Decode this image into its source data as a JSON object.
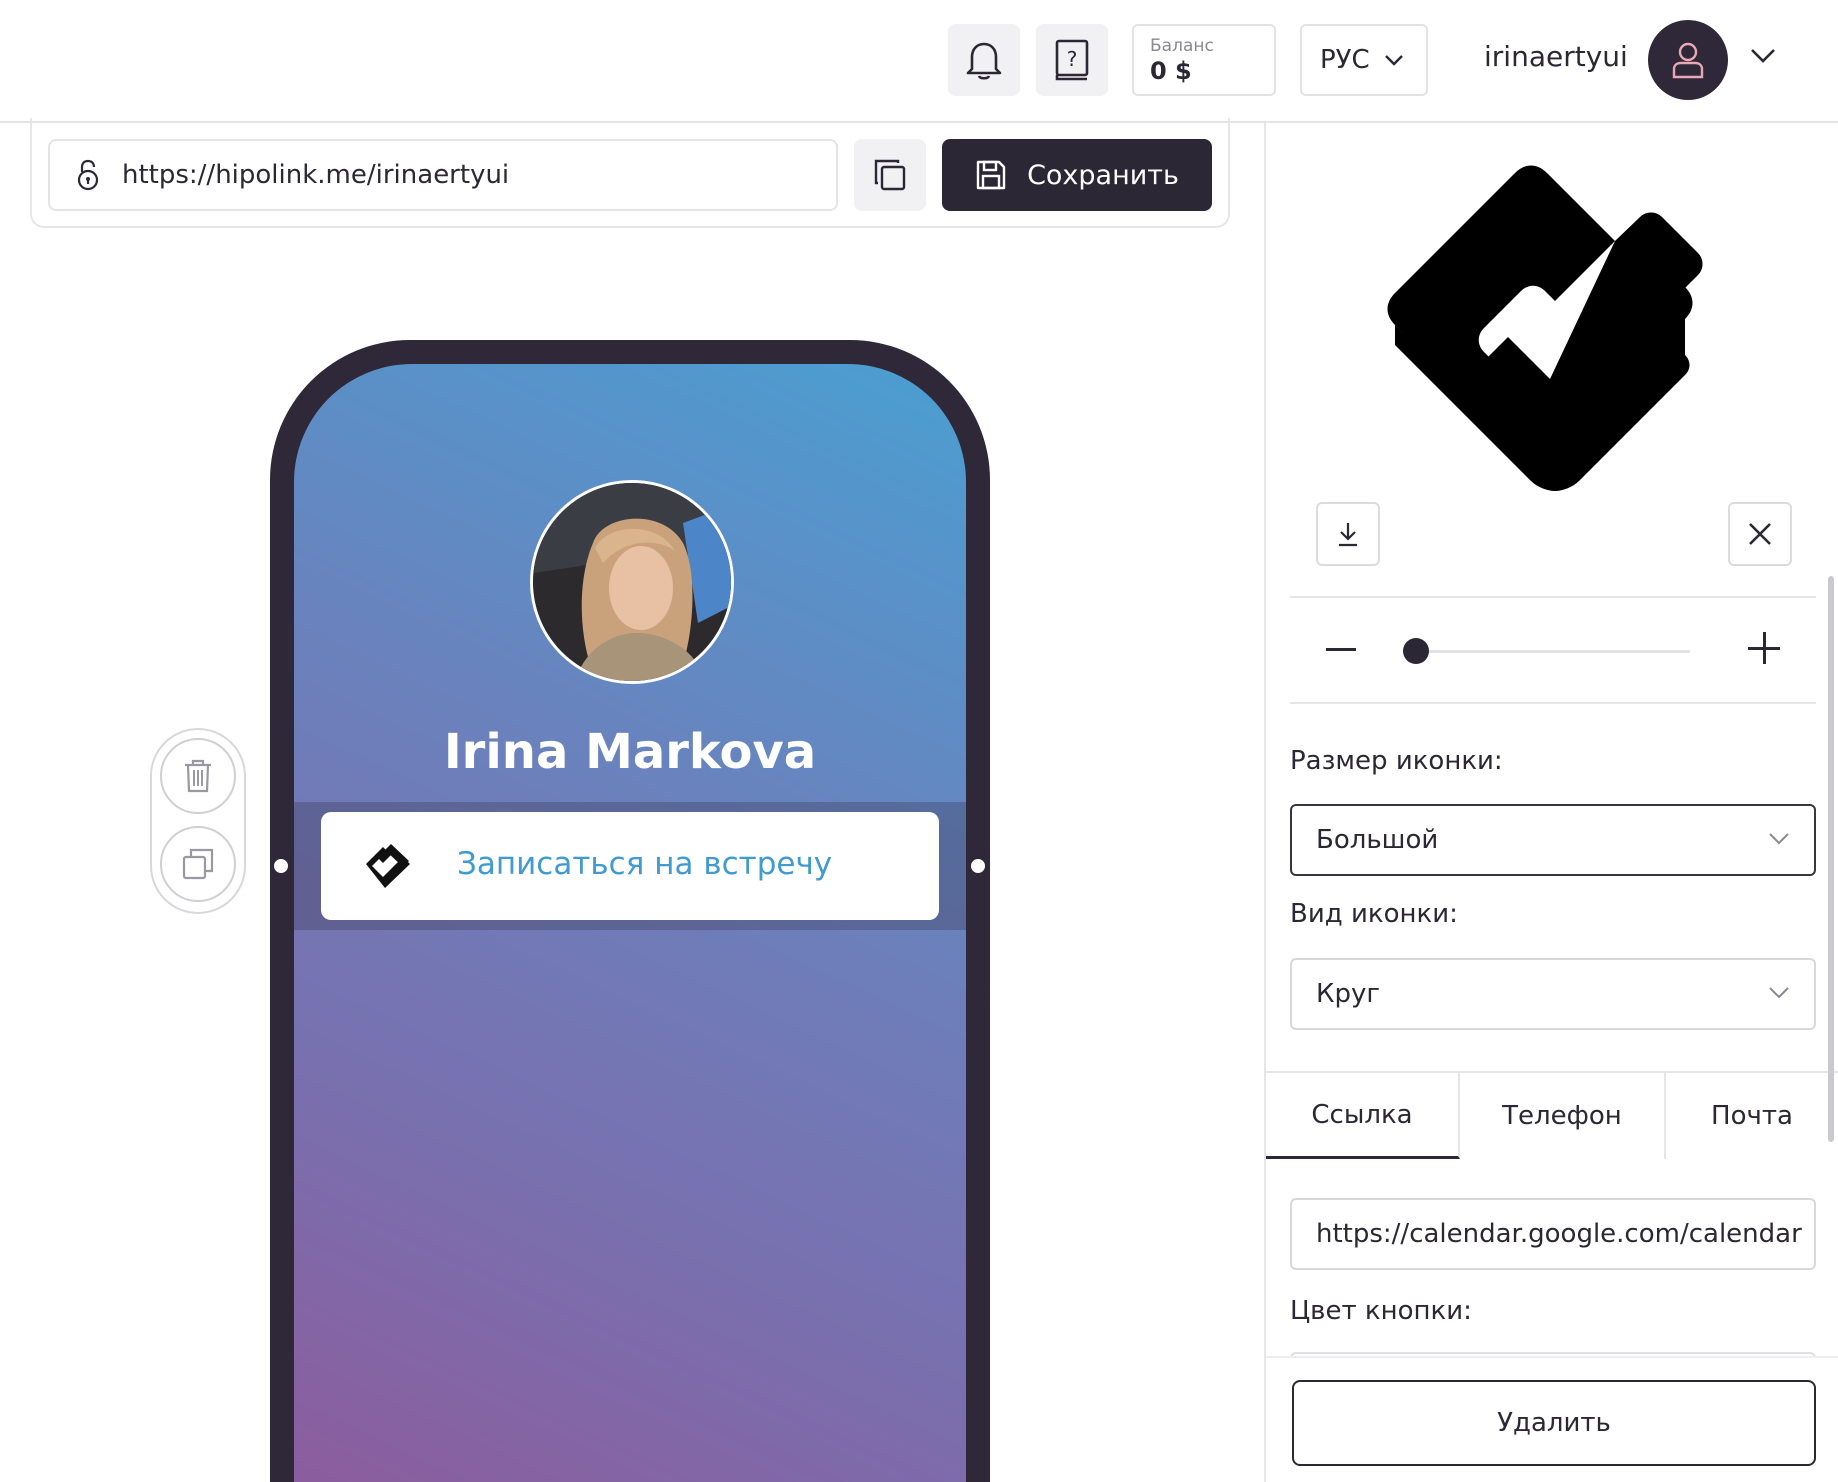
{
  "header": {
    "balance_label": "Баланс",
    "balance_value": "0 $",
    "language": "РУС",
    "username": "irinaertyui"
  },
  "urlbar": {
    "url": "https://hipolink.me/irinaertyui",
    "save_label": "Сохранить"
  },
  "preview": {
    "profile_name": "Irina Markova",
    "button_text": "Записаться на встречу"
  },
  "panel": {
    "zoom": {
      "value": 0
    },
    "icon_size_label": "Размер иконки:",
    "icon_size_value": "Большой",
    "icon_type_label": "Вид иконки:",
    "icon_type_value": "Круг",
    "tabs": [
      {
        "label": "Ссылка",
        "active": true
      },
      {
        "label": "Телефон",
        "active": false
      },
      {
        "label": "Почта",
        "active": false
      }
    ],
    "link_value": "https://calendar.google.com/calendar",
    "button_color_label": "Цвет кнопки:",
    "delete_label": "Удалить"
  },
  "colors": {
    "dark": "#2b2735",
    "phone_frame": "#2f2838",
    "link_text": "#3f9bd0"
  }
}
